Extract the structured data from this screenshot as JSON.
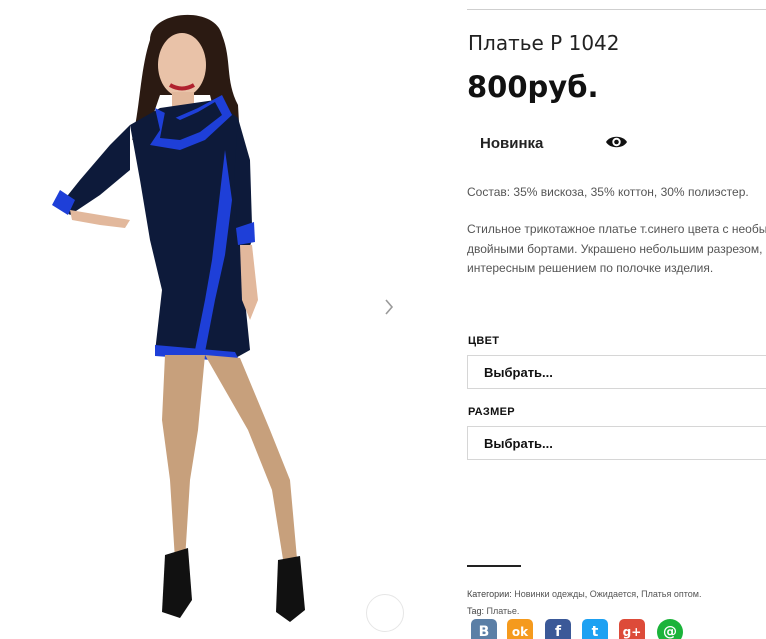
{
  "product": {
    "title": "Платье Р 1042",
    "price": "800руб.",
    "badge": "Новинка",
    "composition": "Состав: 35% вискоза, 35% коттон, 30% полиэстер.",
    "description_lines": [
      "Стильное трикотажное платье т.синего цвета с необыч",
      "двойными бортами. Украшено небольшим разрезом, с",
      "интересным решением по полочке изделия."
    ]
  },
  "options": {
    "color_label": "ЦВЕТ",
    "color_value": "Выбрать...",
    "size_label": "РАЗМЕР",
    "size_value": "Выбрать..."
  },
  "meta": {
    "categories_label": "Категории:",
    "categories": [
      "Новинки одежды",
      "Ожидается",
      "Платья оптом."
    ],
    "tag_label": "Tag:",
    "tag": "Платье."
  },
  "icons": {
    "next": "chevron-right-icon",
    "eye": "eye-icon",
    "zoom": "zoom-icon"
  },
  "social": [
    {
      "name": "vkontakte-share-icon",
      "glyph": "В",
      "color": "#5b7fa6"
    },
    {
      "name": "odnoklassniki-share-icon",
      "glyph": "ok",
      "color": "#f59a1d"
    },
    {
      "name": "facebook-share-icon",
      "glyph": "f",
      "color": "#3b5998"
    },
    {
      "name": "twitter-share-icon",
      "glyph": "t",
      "color": "#1da1f2"
    },
    {
      "name": "google-plus-share-icon",
      "glyph": "g+",
      "color": "#dd4b39"
    },
    {
      "name": "mailru-share-icon",
      "glyph": "@",
      "color": "#1bb33a"
    }
  ],
  "colors": {
    "accent": "#111111",
    "dress": "#0d1a3a",
    "trim": "#1e3fd8"
  }
}
